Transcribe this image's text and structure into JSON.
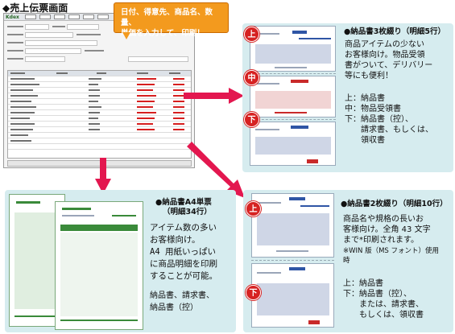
{
  "title": "◆売上伝票画面",
  "callout": {
    "line1": "日付、得意先、商品名、数量、",
    "line2": "単価を入力して、印刷！"
  },
  "screenshot": {
    "logo": "Kdex"
  },
  "stamps": {
    "top": "上",
    "middle": "中",
    "bottom": "下"
  },
  "colors": {
    "callout": "#f39a1e",
    "arrow": "#e3174f",
    "panel": "#d6ecef",
    "stamp": "#d62222"
  },
  "panels": {
    "three_part": {
      "title": "●納品書3枚綴り（明細5行）",
      "desc": [
        "商品アイテムの少ない",
        "お客様向け。物品受領",
        "書がついて、デリバリー",
        "等にも便利！"
      ],
      "items": [
        "上：納品書",
        "中：物品受領書",
        "下：納品書（控）、",
        "　　請求書、もしくは、",
        "　　領収書"
      ]
    },
    "a4": {
      "title_line1": "●納品書A4単票",
      "title_line2": "（明細34行）",
      "desc": [
        "アイテム数の多い",
        "お客様向け。",
        "A4 用紙いっぱい",
        "に商品明細を印刷",
        "することが可能。"
      ],
      "items": [
        "納品書、請求書、",
        "納品書（控）"
      ]
    },
    "two_part": {
      "title": "●納品書2枚綴り（明細10行）",
      "desc": [
        "商品名や規格の長いお",
        "客様向け。全角 43 文字",
        "まで*印刷されます。"
      ],
      "note": [
        "※WIN 版（MS フォント）使用",
        "時"
      ],
      "items": [
        "上：納品書",
        "下：納品書（控）、",
        "　　または、請求書、",
        "　　もしくは、領収書"
      ]
    }
  }
}
